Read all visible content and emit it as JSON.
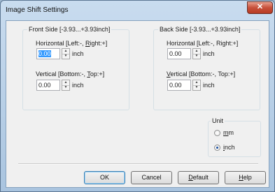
{
  "window": {
    "title": "Image Shift Settings",
    "close_glyph": "✕"
  },
  "front": {
    "label": "Front Side [-3.93...+3.93inch]",
    "horizontal": {
      "pre": "Horizontal [Left:-, ",
      "key": "R",
      "post": "ight:+]",
      "value": "0.00",
      "unit": "inch"
    },
    "vertical": {
      "pre": "Vertical [Bottom:-, ",
      "key": "T",
      "post": "op:+]",
      "value": "0.00",
      "unit": "inch"
    }
  },
  "back": {
    "label": "Back Side [-3.93...+3.93inch]",
    "horizontal": {
      "pre": "Horizontal [Left:-, Right:+]",
      "value": "0.00",
      "unit": "inch"
    },
    "vertical": {
      "key": "V",
      "post": "ertical [Bottom:-, Top:+]",
      "value": "0.00",
      "unit": "inch"
    }
  },
  "unit": {
    "label": "Unit",
    "options": [
      {
        "key": "m",
        "post": "m",
        "checked": false
      },
      {
        "key": "i",
        "post": "nch",
        "checked": true
      }
    ]
  },
  "buttons": {
    "ok": "OK",
    "cancel": "Cancel",
    "default_key": "D",
    "default_post": "efault",
    "help_key": "H",
    "help_post": "elp"
  }
}
